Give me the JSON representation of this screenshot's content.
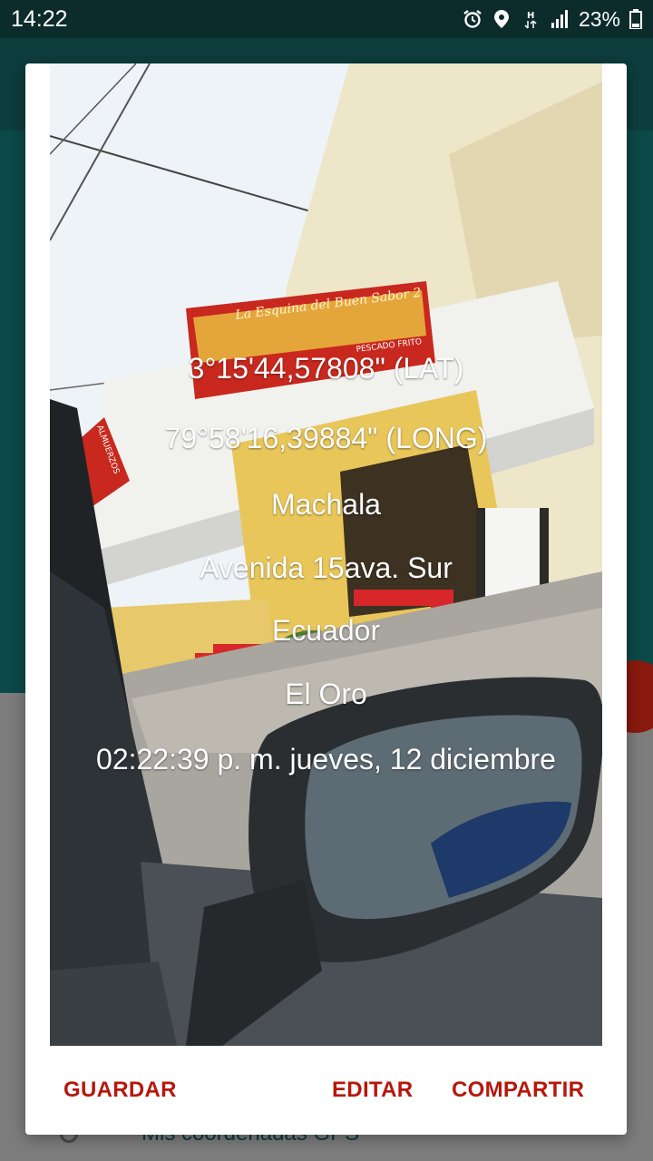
{
  "status_bar": {
    "time": "14:22",
    "battery": "23%",
    "icons": [
      "alarm-icon",
      "location-icon",
      "data-h-icon",
      "signal-icon",
      "battery-icon"
    ]
  },
  "background_app": {
    "menu_item_label": "Mis coordenadas GPS"
  },
  "photo_overlay": {
    "latitude": "3°15'44,57808\" (LAT)",
    "longitude": "79°58'16,39884\" (LONG)",
    "city": "Machala",
    "street": "Avenida 15ava. Sur",
    "country": "Ecuador",
    "province": "El Oro",
    "datetime": "02:22:39 p. m. jueves, 12 diciembre"
  },
  "sign_text": {
    "main": "La Esquina del Buen Sabor 2",
    "sub": "PESCADO FRITO",
    "side": "ALMUERZOS"
  },
  "dialog_actions": {
    "save": "GUARDAR",
    "edit": "EDITAR",
    "share": "COMPARTIR"
  },
  "colors": {
    "accent": "#b7170b",
    "app_primary_dark": "#0c2b2b",
    "app_primary": "#0b4a48"
  }
}
